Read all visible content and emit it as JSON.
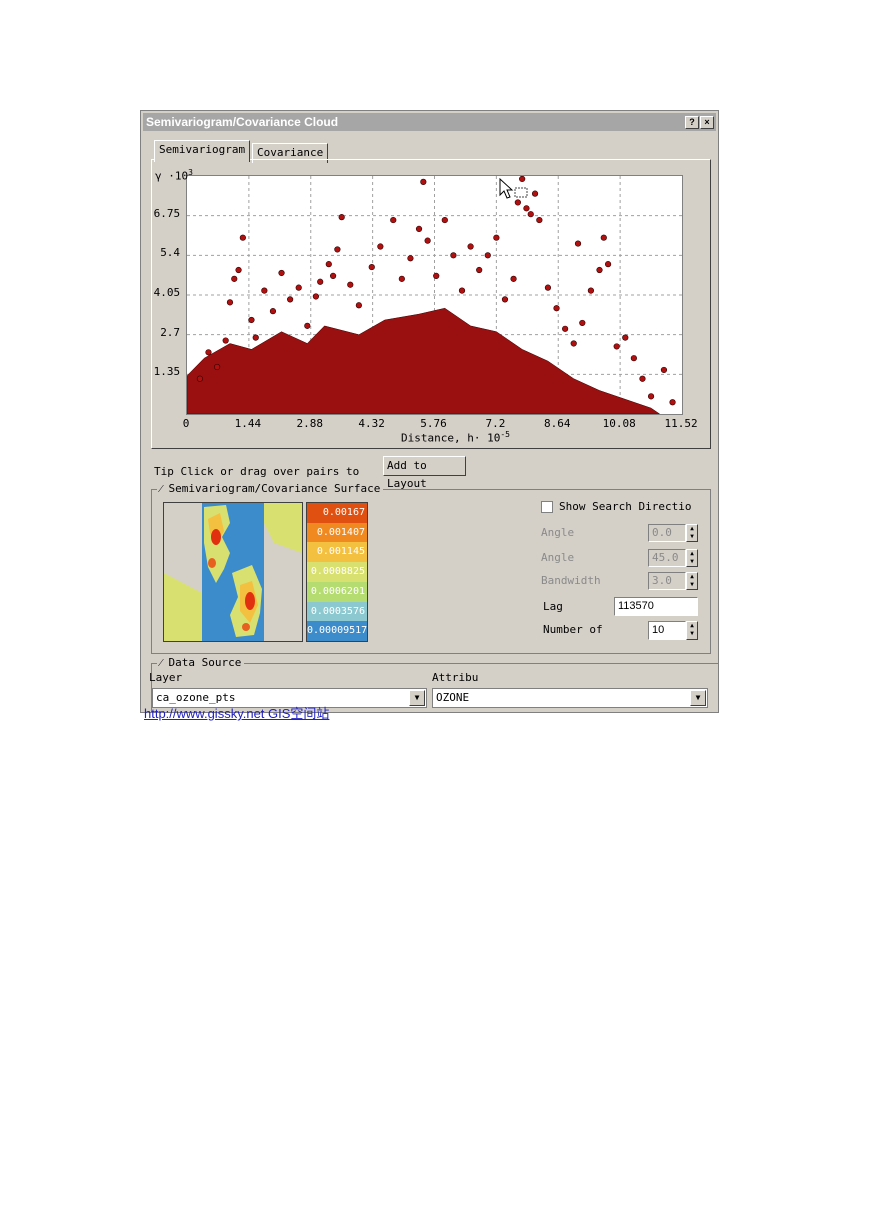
{
  "window": {
    "title": "Semivariogram/Covariance Cloud",
    "help_label": "?",
    "close_label": "×"
  },
  "tabs": [
    {
      "label": "Semivariogram",
      "active": true
    },
    {
      "label": "Covariance",
      "active": false
    }
  ],
  "chart_data": {
    "type": "scatter",
    "ylabel": "γ ·10",
    "ylabel_exponent": "3",
    "xlabel": "Distance, h· 10",
    "xlabel_exponent": "-5",
    "x_ticks": [
      "0",
      "1.44",
      "2.88",
      "4.32",
      "5.76",
      "7.2",
      "8.64",
      "10.08",
      "11.52"
    ],
    "y_ticks": [
      "1.35",
      "2.7",
      "4.05",
      "5.4",
      "6.75"
    ],
    "xlim": [
      0,
      11.52
    ],
    "ylim": [
      0,
      8.1
    ],
    "grid": true,
    "point_color": "#b01010",
    "points": [
      [
        0.3,
        1.2
      ],
      [
        0.5,
        2.1
      ],
      [
        0.7,
        1.6
      ],
      [
        0.9,
        2.5
      ],
      [
        1.0,
        3.8
      ],
      [
        1.1,
        4.6
      ],
      [
        1.2,
        4.9
      ],
      [
        1.3,
        6.0
      ],
      [
        1.5,
        3.2
      ],
      [
        1.6,
        2.6
      ],
      [
        1.8,
        4.2
      ],
      [
        2.0,
        3.5
      ],
      [
        2.2,
        4.8
      ],
      [
        2.4,
        3.9
      ],
      [
        2.6,
        4.3
      ],
      [
        2.8,
        3.0
      ],
      [
        3.0,
        4.0
      ],
      [
        3.1,
        4.5
      ],
      [
        3.3,
        5.1
      ],
      [
        3.4,
        4.7
      ],
      [
        3.5,
        5.6
      ],
      [
        3.6,
        6.7
      ],
      [
        3.8,
        4.4
      ],
      [
        4.0,
        3.7
      ],
      [
        4.3,
        5.0
      ],
      [
        4.5,
        5.7
      ],
      [
        4.8,
        6.6
      ],
      [
        5.0,
        4.6
      ],
      [
        5.2,
        5.3
      ],
      [
        5.4,
        6.3
      ],
      [
        5.6,
        5.9
      ],
      [
        5.8,
        4.7
      ],
      [
        6.0,
        6.6
      ],
      [
        6.2,
        5.4
      ],
      [
        6.4,
        4.2
      ],
      [
        6.6,
        5.7
      ],
      [
        6.8,
        4.9
      ],
      [
        7.0,
        5.4
      ],
      [
        7.2,
        6.0
      ],
      [
        7.4,
        3.9
      ],
      [
        7.6,
        4.6
      ],
      [
        7.7,
        7.2
      ],
      [
        7.8,
        8.0
      ],
      [
        7.9,
        7.0
      ],
      [
        8.0,
        6.8
      ],
      [
        8.1,
        7.5
      ],
      [
        8.2,
        6.6
      ],
      [
        8.4,
        4.3
      ],
      [
        8.6,
        3.6
      ],
      [
        8.8,
        2.9
      ],
      [
        9.0,
        2.4
      ],
      [
        9.2,
        3.1
      ],
      [
        9.4,
        4.2
      ],
      [
        9.6,
        4.9
      ],
      [
        9.7,
        6.0
      ],
      [
        9.8,
        5.1
      ],
      [
        10.0,
        2.3
      ],
      [
        10.2,
        2.6
      ],
      [
        10.4,
        1.9
      ],
      [
        10.6,
        1.2
      ],
      [
        10.8,
        0.6
      ],
      [
        11.1,
        1.5
      ],
      [
        11.3,
        0.4
      ],
      [
        5.5,
        7.9
      ],
      [
        9.1,
        5.8
      ]
    ]
  },
  "tip": {
    "text": "Tip  Click or drag over pairs to",
    "button_label": "Add to Layout"
  },
  "surface": {
    "group_title": "Semivariogram/Covariance Surface",
    "legend": [
      "0.00167",
      "0.001407",
      "0.001145",
      "0.0008825",
      "0.0006201",
      "0.0003576",
      "0.00009517"
    ],
    "legend_colors": [
      "#e05010",
      "#f08a20",
      "#f4c040",
      "#d8e070",
      "#b4dc70",
      "#8cc8d0",
      "#3c8ccc"
    ],
    "show_search_label": "Show Search Directio",
    "angle1_label": "Angle",
    "angle1_value": "0.0",
    "angle2_label": "Angle",
    "angle2_value": "45.0",
    "bandwidth_label": "Bandwidth",
    "bandwidth_value": "3.0",
    "lag_label": "Lag",
    "lag_value": "113570",
    "number_label": "Number of",
    "number_value": "10"
  },
  "datasource": {
    "group_title": "Data Source",
    "layer_label": "Layer",
    "layer_value": "ca_ozone_pts",
    "attribute_label": "Attribu",
    "attribute_value": "OZONE"
  },
  "watermark": "http://www.gissky.net    GIS空间站"
}
